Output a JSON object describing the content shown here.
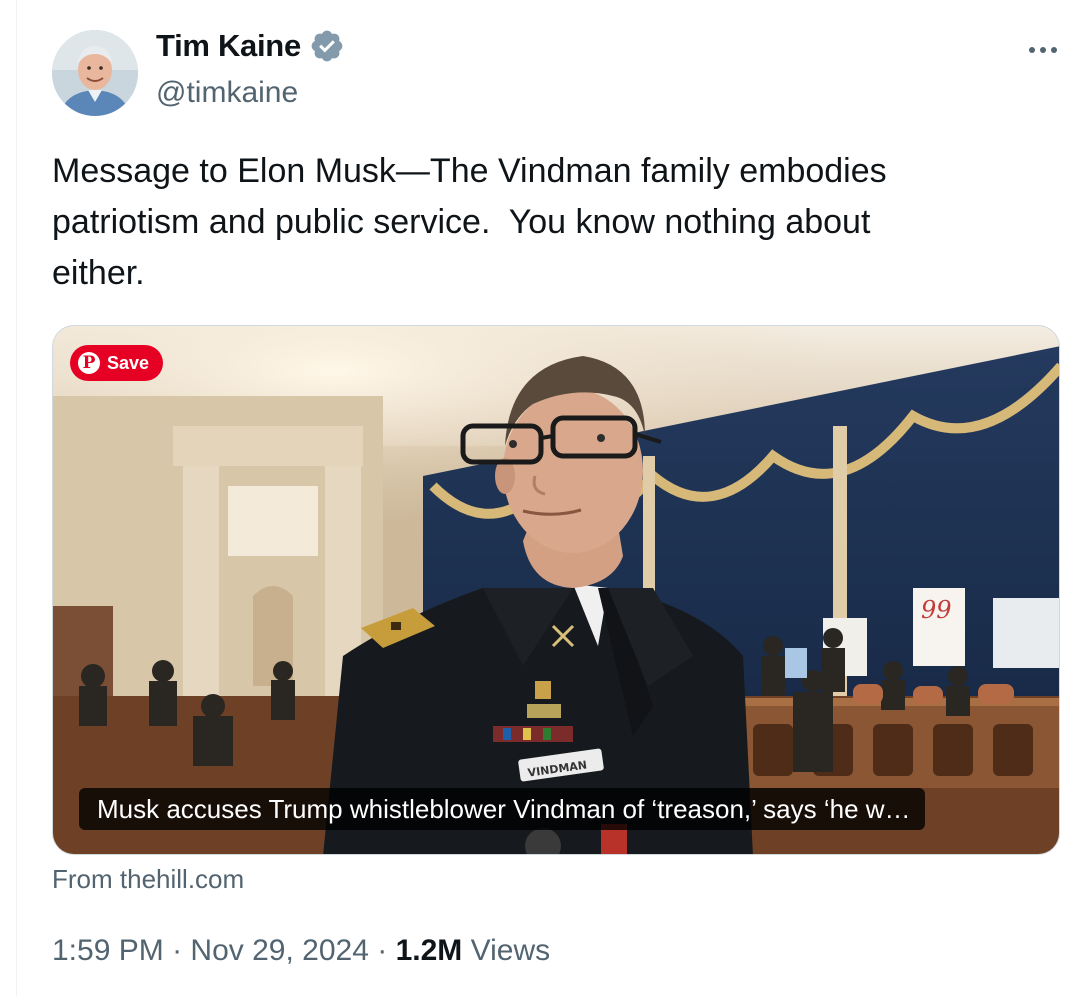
{
  "author": {
    "display_name": "Tim Kaine",
    "handle": "@timkaine",
    "verified_icon": "verified-badge-icon",
    "verified_color": "#829aab"
  },
  "more_icon": "more-dots-icon",
  "tweet": {
    "text": "Message to Elon Musk—The Vindman family embodies\npatriotism and public service.  You know nothing about\neither."
  },
  "card": {
    "save_label": "Save",
    "save_color": "#e60023",
    "pin_icon": "pinterest-icon",
    "title": "Musk accuses Trump whistleblower Vindman of ‘treason,’ says ‘he w…",
    "nametag": "VINDMAN",
    "sign_number": "99",
    "source": "From thehill.com"
  },
  "meta": {
    "time": "1:59 PM",
    "separator": "·",
    "date": "Nov 29, 2024",
    "views_count": "1.2M",
    "views_label": "Views"
  }
}
